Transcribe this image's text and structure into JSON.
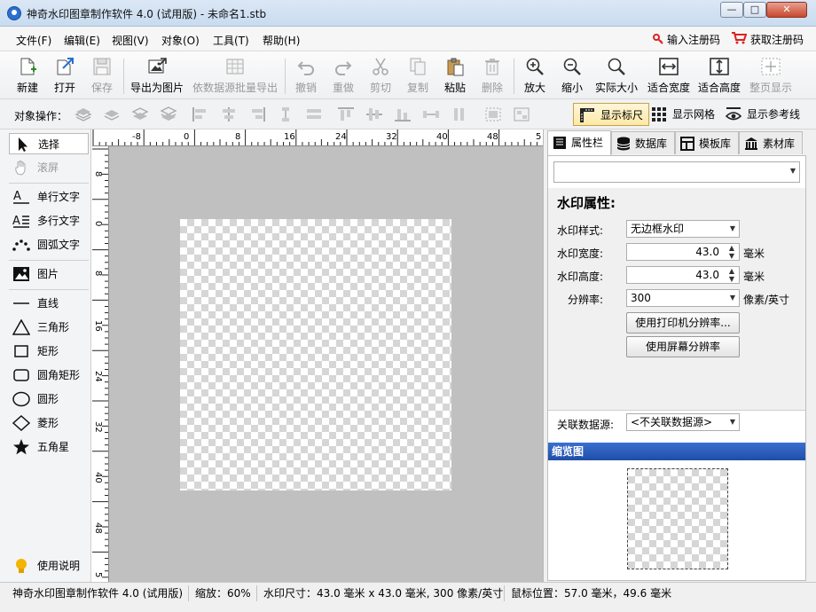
{
  "window": {
    "title": "神奇水印图章制作软件 4.0 (试用版) - 未命名1.stb",
    "min_label": "—",
    "max_label": "□",
    "close_label": "✕"
  },
  "menu": {
    "items": [
      "文件(F)",
      "编辑(E)",
      "视图(V)",
      "对象(O)",
      "工具(T)",
      "帮助(H)"
    ],
    "register_code": "输入注册码",
    "get_code": "获取注册码"
  },
  "toolbar": {
    "new": "新建",
    "open": "打开",
    "save": "保存",
    "export_image": "导出为图片",
    "batch_export": "依数据源批量导出",
    "undo": "撤销",
    "redo": "重做",
    "cut": "剪切",
    "copy": "复制",
    "paste": "粘贴",
    "delete": "删除",
    "zoom_in": "放大",
    "zoom_out": "缩小",
    "actual_size": "实际大小",
    "fit_width": "适合宽度",
    "fit_height": "适合高度",
    "full_page": "整页显示"
  },
  "objbar": {
    "label": "对象操作：",
    "show_ruler": "显示标尺",
    "show_grid": "显示网格",
    "show_guides": "显示参考线"
  },
  "tools": {
    "select": "选择",
    "scroll": "滚屏",
    "single_text": "单行文字",
    "multi_text": "多行文字",
    "arc_text": "圆弧文字",
    "image": "图片",
    "line": "直线",
    "triangle": "三角形",
    "rect": "矩形",
    "round_rect": "圆角矩形",
    "circle": "圆形",
    "diamond": "菱形",
    "star": "五角星",
    "help": "使用说明"
  },
  "ruler": {
    "top_ticks": [
      "-8",
      "0",
      "8",
      "16",
      "24",
      "32",
      "40",
      "48",
      "5"
    ],
    "left_ticks": [
      "8",
      "0",
      "8",
      "16",
      "24",
      "32",
      "40",
      "48",
      "5"
    ]
  },
  "right_panel": {
    "tabs": [
      "属性栏",
      "数据库",
      "模板库",
      "素材库"
    ],
    "object_combo": "",
    "section_title": "水印属性:",
    "style_label": "水印样式:",
    "style_value": "无边框水印",
    "width_label": "水印宽度:",
    "width_value": "43.0",
    "width_unit": "毫米",
    "height_label": "水印高度:",
    "height_value": "43.0",
    "height_unit": "毫米",
    "dpi_label": "分辨率:",
    "dpi_value": "300",
    "dpi_unit": "像素/英寸",
    "printer_dpi_btn": "使用打印机分辨率...",
    "screen_dpi_btn": "使用屏幕分辨率",
    "datasource_label": "关联数据源:",
    "datasource_value": "<不关联数据源>",
    "preview_title": "缩览图"
  },
  "status": {
    "app": "神奇水印图章制作软件 4.0 (试用版)",
    "zoom": "缩放：60%",
    "size": "水印尺寸：43.0 毫米 x 43.0 毫米, 300 像素/英寸",
    "mouse": "鼠标位置：57.0 毫米，49.6 毫米"
  }
}
